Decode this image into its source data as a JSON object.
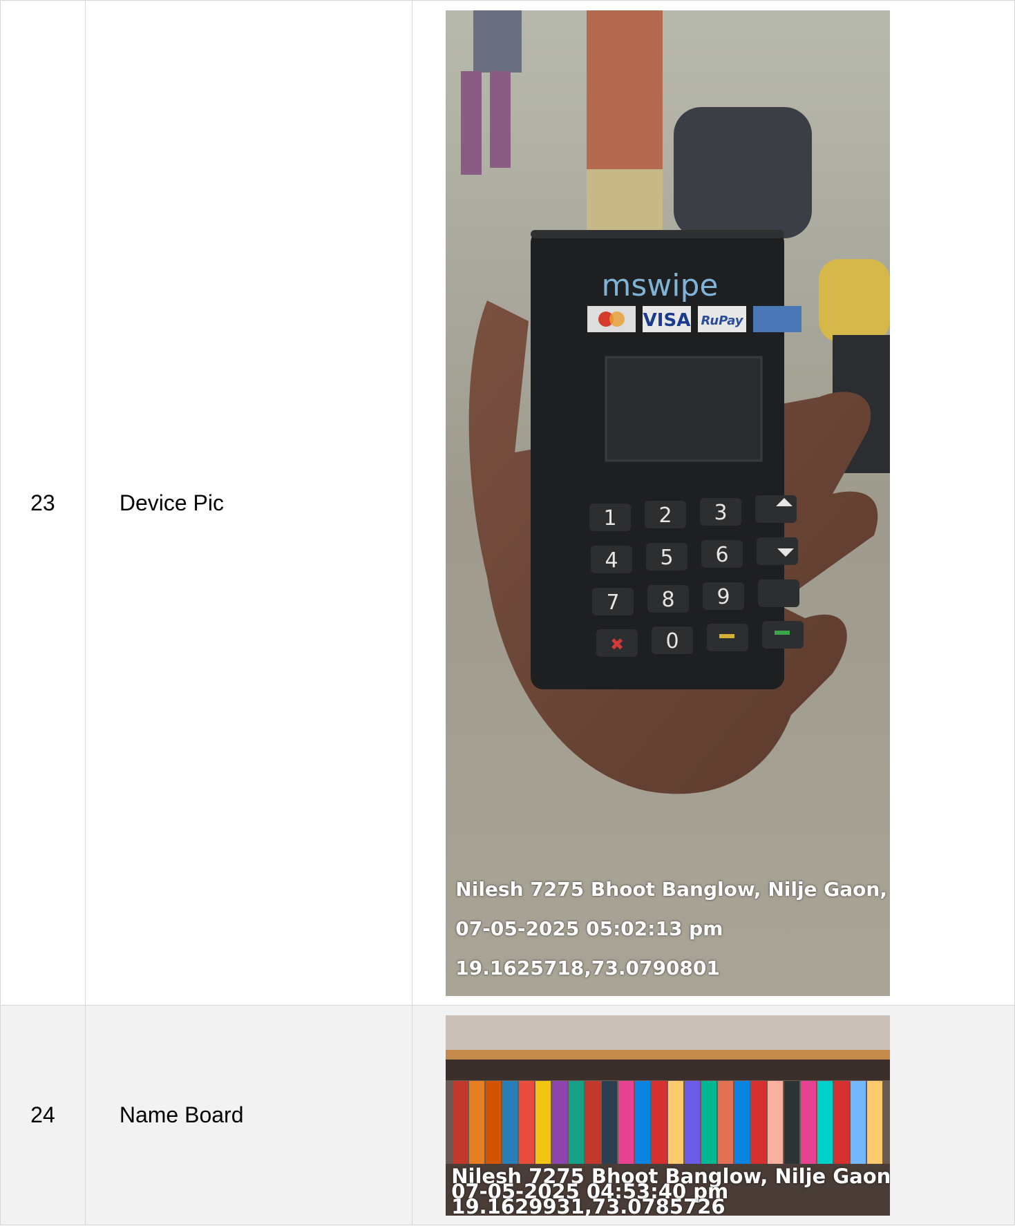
{
  "rows": [
    {
      "sno": "23",
      "label": "Device Pic",
      "photo": {
        "subject": "mswipe card terminal",
        "brand_text": "mswipe",
        "card_logos": [
          "VISA",
          "RuPay"
        ],
        "keys": [
          "1",
          "2",
          "3",
          "4",
          "5",
          "6",
          "7",
          "8",
          "9",
          "0"
        ],
        "overlay": {
          "address": "Nilesh 7275 Bhoot Banglow, Nilje Gaon, ...",
          "timestamp": "07-05-2025 05:02:13 pm",
          "coordinates": "19.1625718,73.0790801"
        }
      }
    },
    {
      "sno": "24",
      "label": "Name Board",
      "photo": {
        "subject": "shop shelf with snack packets",
        "overlay": {
          "address": "Nilesh 7275 Bhoot Banglow, Nilje Gaon, ...",
          "timestamp": "07-05-2025 04:53:40 pm",
          "coordinates": "19.1629931,73.0785726"
        }
      }
    }
  ]
}
